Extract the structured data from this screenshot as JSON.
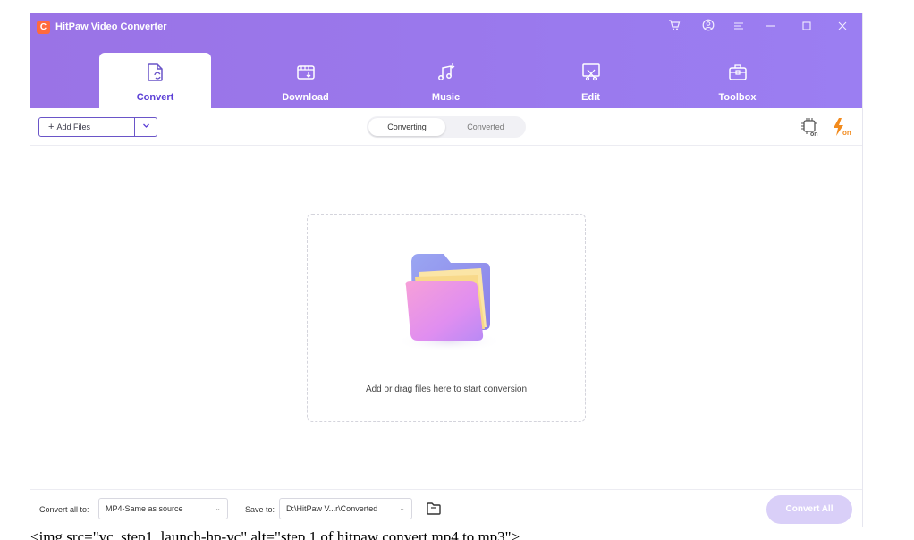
{
  "app": {
    "title": "HitPaw Video Converter",
    "logo_letter": "C"
  },
  "titlebar_icons": [
    "cart-icon",
    "account-icon",
    "menu-icon",
    "minimize-icon",
    "maximize-icon",
    "close-icon"
  ],
  "tabs": [
    {
      "label": "Convert",
      "icon": "convert-icon",
      "active": true
    },
    {
      "label": "Download",
      "icon": "download-icon",
      "active": false
    },
    {
      "label": "Music",
      "icon": "music-icon",
      "active": false
    },
    {
      "label": "Edit",
      "icon": "edit-icon",
      "active": false
    },
    {
      "label": "Toolbox",
      "icon": "toolbox-icon",
      "active": false
    }
  ],
  "toolbar": {
    "add_files_label": "Add Files",
    "segments": {
      "active": "Converting",
      "inactive": "Converted"
    },
    "hw_accel_badge": "on",
    "boost_badge": "on"
  },
  "dropzone": {
    "text": "Add or drag files here to start conversion"
  },
  "footer": {
    "convert_all_to_label": "Convert all to:",
    "convert_all_to_value": "MP4-Same as source",
    "save_to_label": "Save to:",
    "save_to_value": "D:\\HitPaw V...r\\Converted",
    "convert_all_button": "Convert All"
  },
  "caption": "<img src=\"vc_step1_launch-hp-vc\" alt=\"step 1 of hitpaw convert mp4 to mp3\">",
  "colors": {
    "header_gradient_start": "#9a73e6",
    "header_gradient_end": "#9b7ef2",
    "accent": "#6a55c8",
    "convert_all_disabled": "#d9cff8",
    "boost_orange": "#f28b1e"
  }
}
